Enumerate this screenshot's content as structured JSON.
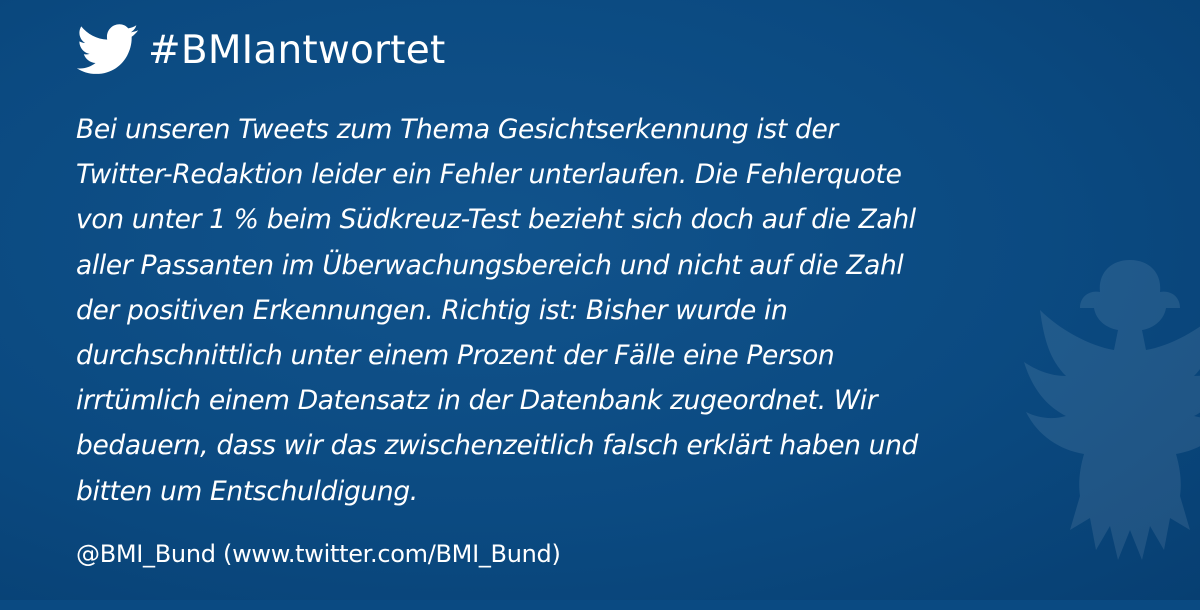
{
  "colors": {
    "background": "#0a4a82",
    "text": "#ffffff"
  },
  "header": {
    "icon": "twitter-bird-icon",
    "hashtag": "#BMIantwortet"
  },
  "statement": {
    "lines": [
      "Bei unseren Tweets zum Thema Gesichtserkennung ist der",
      "Twitter-Redaktion leider ein Fehler unterlaufen. Die Fehlerquote",
      "von unter 1 % beim Südkreuz-Test bezieht sich doch auf die Zahl",
      "aller Passanten im Überwachungsbereich und nicht auf die Zahl",
      "der positiven Erkennungen. Richtig ist: Bisher wurde in",
      "durchschnittlich unter einem Prozent der Fälle eine Person",
      "irrtümlich einem Datensatz in der Datenbank zugeordnet. Wir",
      "bedauern, dass wir das zwischenzeitlich falsch erklärt haben und",
      "bitten um Entschuldigung."
    ]
  },
  "footer": {
    "handle": "@BMI_Bund (www.twitter.com/BMI_Bund)"
  },
  "background_emblem": "federal-eagle-icon"
}
